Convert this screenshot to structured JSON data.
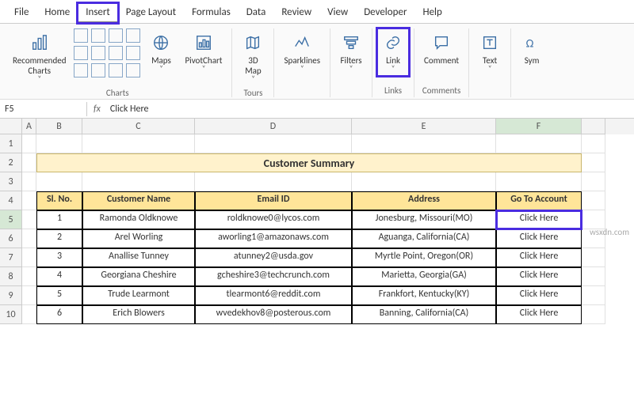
{
  "ribbon": {
    "tabs": [
      "File",
      "Home",
      "Insert",
      "Page Layout",
      "Formulas",
      "Data",
      "Review",
      "View",
      "Developer",
      "Help"
    ],
    "active_tab": "Insert",
    "groups": {
      "charts": {
        "recommended": "Recommended\nCharts",
        "maps": "Maps",
        "pivot": "PivotChart",
        "label": "Charts"
      },
      "tours": {
        "map3d": "3D\nMap",
        "label": "Tours"
      },
      "sparklines": {
        "btn": "Sparklines"
      },
      "filters": {
        "btn": "Filters"
      },
      "links": {
        "btn": "Link",
        "label": "Links"
      },
      "comments": {
        "btn": "Comment",
        "label": "Comments"
      },
      "text": {
        "btn": "Text"
      },
      "sym": {
        "btn": "Sym"
      }
    }
  },
  "formula_bar": {
    "name_box": "F5",
    "content": "Click Here"
  },
  "columns": [
    "A",
    "B",
    "C",
    "D",
    "E",
    "F"
  ],
  "title": "Customer Summary",
  "headers": {
    "sl": "Sl. No.",
    "name": "Customer Name",
    "email": "Email ID",
    "addr": "Address",
    "goto": "Go To Account"
  },
  "rows": [
    {
      "n": "1",
      "name": "Ramonda Oldknowe",
      "email": "roldknowe0@lycos.com",
      "addr": "Jonesburg, Missouri(MO)",
      "link": "Click Here"
    },
    {
      "n": "2",
      "name": "Arel Worling",
      "email": "aworling1@amazonaws.com",
      "addr": "Aguanga, California(CA)",
      "link": "Click Here"
    },
    {
      "n": "3",
      "name": "Anallise Tunney",
      "email": "atunney2@usda.gov",
      "addr": "Myrtle Point, Oregon(OR)",
      "link": "Click Here"
    },
    {
      "n": "4",
      "name": "Georgiana Cheshire",
      "email": "gcheshire3@techcrunch.com",
      "addr": "Marietta, Georgia(GA)",
      "link": "Click Here"
    },
    {
      "n": "5",
      "name": "Trude Learmont",
      "email": "tlearmont6@reddit.com",
      "addr": "Frankfort, Kentucky(KY)",
      "link": "Click Here"
    },
    {
      "n": "6",
      "name": "Erich Blowers",
      "email": "wvedekhov8@posterous.com",
      "addr": "Banning, California(CA)",
      "link": "Click Here"
    }
  ],
  "selected_cell": "F5",
  "selected_row": 5,
  "selected_col": "F",
  "watermark": "wsxdn.com"
}
